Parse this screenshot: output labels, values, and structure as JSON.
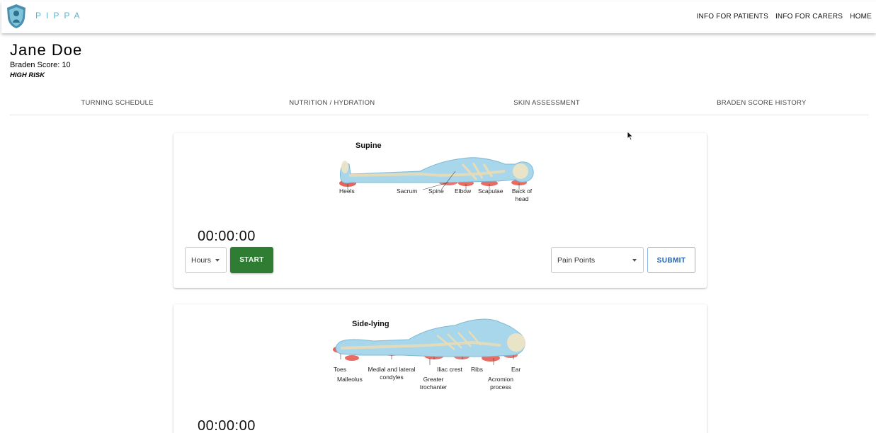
{
  "app": {
    "brand": "PIPPA",
    "nav": [
      "INFO FOR PATIENTS",
      "INFO FOR CARERS",
      "HOME"
    ]
  },
  "patient": {
    "name": "Jane Doe",
    "braden_score": "Braden Score: 10",
    "risk": "HIGH RISK"
  },
  "tabs": [
    "TURNING SCHEDULE",
    "NUTRITION / HYDRATION",
    "SKIN ASSESSMENT",
    "BRADEN SCORE HISTORY"
  ],
  "cards": [
    {
      "position_title": "Supine",
      "labels": [
        "Heels",
        "Sacrum",
        "Spine",
        "Elbow",
        "Scapulae",
        "Back of head"
      ],
      "timer": "00:00:00",
      "hours_select": "Hours",
      "start_label": "START",
      "pain_select": "Pain Points",
      "submit_label": "SUBMIT"
    },
    {
      "position_title": "Side-lying",
      "labels": [
        "Toes",
        "Medial and lateral condyles",
        "Iliac crest",
        "Ribs",
        "Ear",
        "Malleolus",
        "Greater trochanter",
        "Acromion process"
      ],
      "timer": "00:00:00"
    }
  ],
  "colors": {
    "brand": "#5fb3c9",
    "start_button": "#2e7d32",
    "submit_text": "#1e5fb4",
    "pressure_point": "#e23b2e"
  },
  "icons": [
    "shield-logo-icon",
    "dropdown-caret-icon",
    "mouse-cursor-icon"
  ]
}
